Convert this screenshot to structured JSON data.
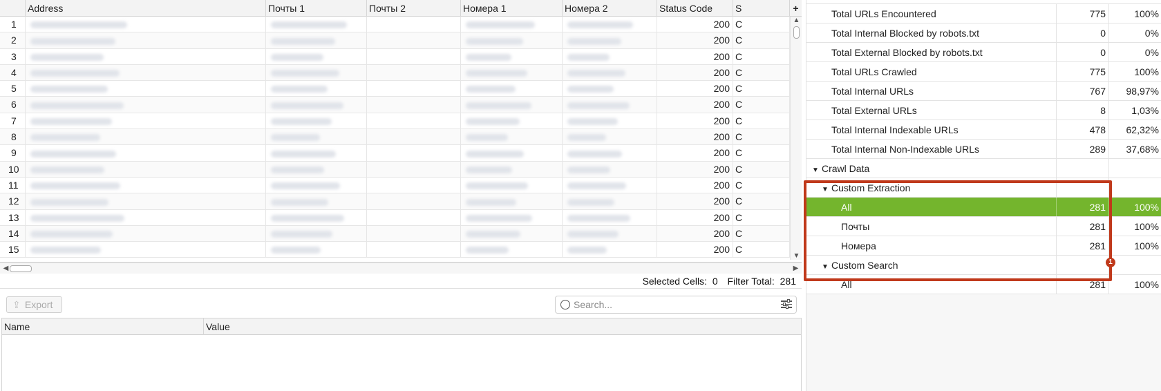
{
  "grid": {
    "columns": [
      "",
      "Address",
      "Почты 1",
      "Почты 2",
      "Номера 1",
      "Номера 2",
      "Status Code",
      "S"
    ],
    "add_column_symbol": "+",
    "rows": [
      {
        "n": "1",
        "status": "200",
        "tail": "C"
      },
      {
        "n": "2",
        "status": "200",
        "tail": "C"
      },
      {
        "n": "3",
        "status": "200",
        "tail": "C"
      },
      {
        "n": "4",
        "status": "200",
        "tail": "C"
      },
      {
        "n": "5",
        "status": "200",
        "tail": "C"
      },
      {
        "n": "6",
        "status": "200",
        "tail": "C"
      },
      {
        "n": "7",
        "status": "200",
        "tail": "C"
      },
      {
        "n": "8",
        "status": "200",
        "tail": "C"
      },
      {
        "n": "9",
        "status": "200",
        "tail": "C"
      },
      {
        "n": "10",
        "status": "200",
        "tail": "C"
      },
      {
        "n": "11",
        "status": "200",
        "tail": "C"
      },
      {
        "n": "12",
        "status": "200",
        "tail": "C"
      },
      {
        "n": "13",
        "status": "200",
        "tail": "C"
      },
      {
        "n": "14",
        "status": "200",
        "tail": "C"
      },
      {
        "n": "15",
        "status": "200",
        "tail": "C"
      }
    ]
  },
  "status_bar": {
    "selected_label": "Selected Cells:",
    "selected_value": "0",
    "filter_label": "Filter Total:",
    "filter_value": "281"
  },
  "toolbar": {
    "export_label": "Export",
    "search_placeholder": "Search..."
  },
  "detail_table": {
    "name_header": "Name",
    "value_header": "Value"
  },
  "tree": {
    "rows": [
      {
        "label": "Total URLs Encountered",
        "count": "775",
        "pct": "100%",
        "level": 2
      },
      {
        "label": "Total Internal Blocked by robots.txt",
        "count": "0",
        "pct": "0%",
        "level": 2
      },
      {
        "label": "Total External Blocked by robots.txt",
        "count": "0",
        "pct": "0%",
        "level": 2
      },
      {
        "label": "Total URLs Crawled",
        "count": "775",
        "pct": "100%",
        "level": 2
      },
      {
        "label": "Total Internal URLs",
        "count": "767",
        "pct": "98,97%",
        "level": 2
      },
      {
        "label": "Total External URLs",
        "count": "8",
        "pct": "1,03%",
        "level": 2
      },
      {
        "label": "Total Internal Indexable URLs",
        "count": "478",
        "pct": "62,32%",
        "level": 2
      },
      {
        "label": "Total Internal Non-Indexable URLs",
        "count": "289",
        "pct": "37,68%",
        "level": 2
      },
      {
        "label": "Crawl Data",
        "count": "",
        "pct": "",
        "level": 1,
        "expanded": true
      },
      {
        "label": "Custom Extraction",
        "count": "",
        "pct": "",
        "level": 2,
        "expanded": true
      },
      {
        "label": "All",
        "count": "281",
        "pct": "100%",
        "level": 3,
        "selected": true
      },
      {
        "label": "Почты",
        "count": "281",
        "pct": "100%",
        "level": 3
      },
      {
        "label": "Номера",
        "count": "281",
        "pct": "100%",
        "level": 3
      },
      {
        "label": "Custom Search",
        "count": "",
        "pct": "",
        "level": 2,
        "expanded": true
      },
      {
        "label": "All",
        "count": "281",
        "pct": "100%",
        "level": 3
      }
    ]
  },
  "annotation": {
    "badge": "1",
    "color": "#c0391b"
  },
  "colors": {
    "selected_row": "#74b52d",
    "highlight": "#c0391b"
  }
}
